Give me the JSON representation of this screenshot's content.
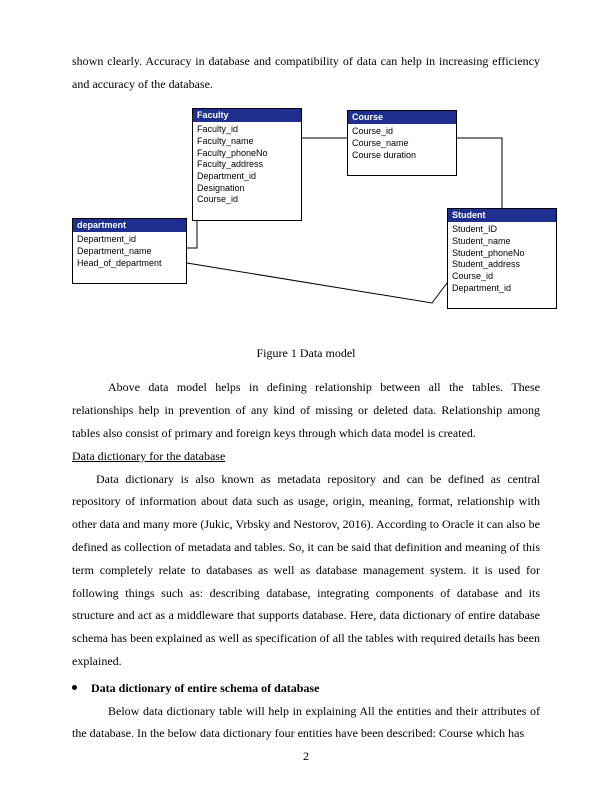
{
  "para_intro": "shown clearly. Accuracy in database and compatibility of data can help in increasing efficiency and accuracy of the database.",
  "entities": {
    "faculty": {
      "title": "Faculty",
      "attrs": [
        "Faculty_id",
        "Faculty_name",
        "Faculty_phoneNo",
        "Faculty_address",
        "Department_id",
        "Designation",
        "Course_id"
      ]
    },
    "course": {
      "title": "Course",
      "attrs": [
        "Course_id",
        "Course_name",
        "Course duration"
      ]
    },
    "department": {
      "title": "department",
      "attrs": [
        "Department_id",
        "Department_name",
        "Head_of_department"
      ]
    },
    "student": {
      "title": "Student",
      "attrs": [
        "Student_ID",
        "Student_name",
        "Student_phoneNo",
        "Student_address",
        "Course_id",
        "Department_id"
      ]
    }
  },
  "figure_caption": "Figure 1 Data model",
  "para_model": "Above data model helps in defining relationship between all the tables. These relationships help in prevention of any kind of missing or deleted data. Relationship among tables also consist of primary and foreign keys through which data model is created.",
  "heading_dict": "Data dictionary for the database",
  "para_dict": "Data dictionary is also known as metadata repository and can be defined as central repository of information about data such as usage, origin, meaning, format, relationship with other data and many more (Jukic, Vrbsky and Nestorov, 2016). According to Oracle it can also be defined as collection of metadata and tables. So, it can be said that definition and meaning of this term completely relate to databases as well as database management system. it is used for following things such as: describing database, integrating components of database and its structure and act as a middleware that supports database. Here, data dictionary of entire database schema has been explained as well as specification of all the tables with required details has been explained.",
  "bullet_heading": "Data dictionary of entire schema of database",
  "para_bullet": "Below data dictionary table will help in explaining All the entities and their attributes of the database. In the below data dictionary four entities have been described: Course which has",
  "page_number": "2"
}
